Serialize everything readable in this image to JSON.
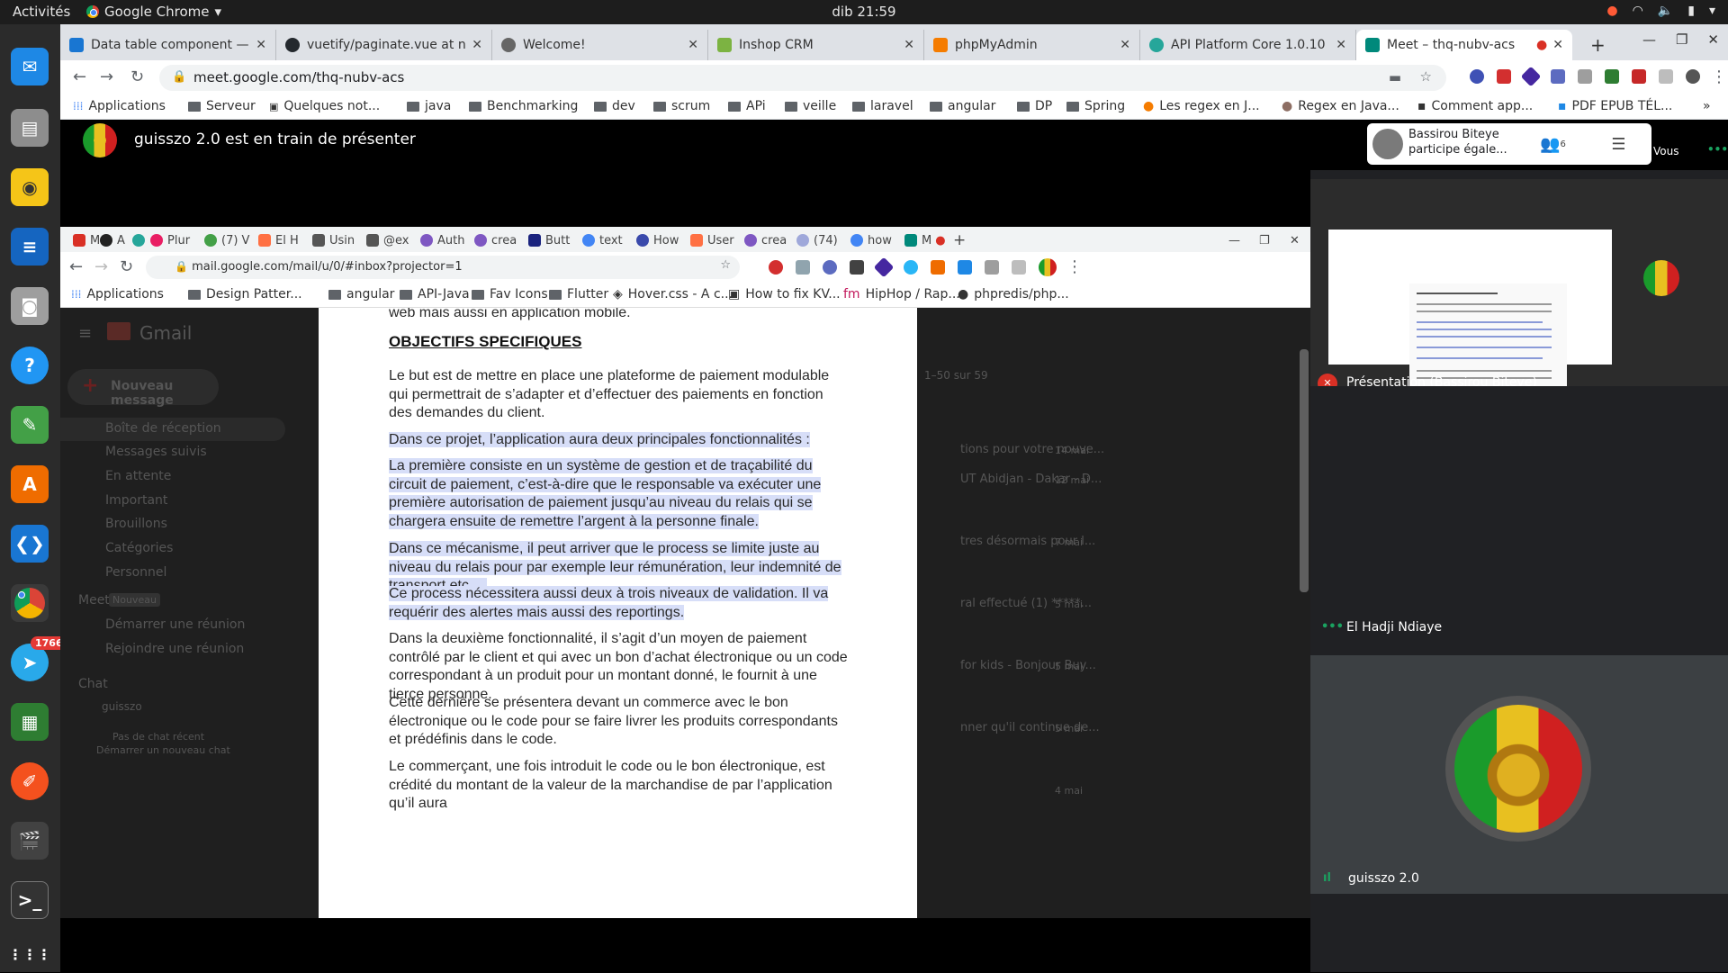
{
  "topbar": {
    "activities": "Activités",
    "app_name": "Google Chrome",
    "clock": "dib 21:59"
  },
  "dock": {
    "telegram_badge": "1766"
  },
  "chrome": {
    "tabs": [
      {
        "title": "Data table component —",
        "color": "#1976d2"
      },
      {
        "title": "vuetify/paginate.vue at n",
        "color": "#24292e"
      },
      {
        "title": "Welcome!",
        "color": "#444444"
      },
      {
        "title": "Inshop CRM",
        "color": "#7cb342"
      },
      {
        "title": "phpMyAdmin",
        "color": "#f57c00"
      },
      {
        "title": "API Platform Core 1.0.10",
        "color": "#26a69a"
      },
      {
        "title": "Meet – thq-nubv-acs",
        "color": "#00897b"
      }
    ],
    "url": "meet.google.com/thq-nubv-acs",
    "bookmarks": [
      "Applications",
      "Serveur",
      "Quelques not...",
      "java",
      "Benchmarking",
      "dev",
      "scrum",
      "APi",
      "veille",
      "laravel",
      "angular",
      "DP",
      "Spring",
      "Les regex en J...",
      "Regex en Java...",
      "Comment app...",
      "PDF EPUB TÉL..."
    ]
  },
  "meet": {
    "presenter_text": "guisszo 2.0 est en train de présenter",
    "toast_name": "Bassirou Biteye",
    "toast_text": "participe égale...",
    "people_count": "6",
    "vous": "Vous",
    "vous_dots": "•••",
    "thumb_label": "Présentation (Bassirou Biteye)",
    "tile2_name": "El Hadji Ndiaye",
    "tile2_dots": "•••",
    "tile3_name": "guisszo 2.0",
    "tile3_audio": "ıl"
  },
  "shared": {
    "tabs": [
      "M",
      "A",
      "",
      "Plur",
      "(7) V",
      "El H",
      "Usin",
      "@ex",
      "Auth",
      "crea",
      "Butt",
      "text",
      "How",
      "User",
      "crea",
      "(74)",
      "how",
      "M"
    ],
    "url": "mail.google.com/mail/u/0/#inbox?projector=1",
    "bookmarks": [
      "Applications",
      "Design Patter...",
      "angular",
      "API-Java",
      "Fav Icons",
      "Flutter",
      "Hover.css - A c...",
      "How to fix KV...",
      "HipHop / Rap...",
      "phpredis/php..."
    ],
    "gmail": {
      "brand": "Gmail",
      "compose": "Nouveau message",
      "nav": [
        "Boîte de réception",
        "Messages suivis",
        "En attente",
        "Important",
        "Brouillons",
        "Catégories",
        "Personnel"
      ],
      "meet_label": "Meet",
      "meet_new": "Nouveau",
      "meet_items": [
        "Démarrer une réunion",
        "Rejoindre une réunion"
      ],
      "chat_label": "Chat",
      "chat_user": "guisszo",
      "chat_empty": "Pas de chat récent",
      "chat_start": "Démarrer un nouveau chat",
      "counter": "1–50 sur 59",
      "snippets": [
        {
          "text": "tions pour votre nouve...",
          "date": "14 mai"
        },
        {
          "text": "UT Abidjan - Dakar - D...",
          "date": "12 mai"
        },
        {
          "text": "tres désormais pour l...",
          "date": "7 mai"
        },
        {
          "text": "ral effectué (1) *****...",
          "date": "5 mai"
        },
        {
          "text": "for kids - Bonjour Buy...",
          "date": "5 mai"
        },
        {
          "text": "nner qu'il continue de...",
          "date": "5 mai"
        },
        {
          "text": "",
          "date": "4 mai"
        }
      ]
    },
    "doc": {
      "line0": "web mais aussi en application mobile.",
      "heading": "OBJECTIFS SPECIFIQUES",
      "p1": "Le but est de mettre en place une plateforme de paiement modulable qui permettrait de s’adapter et d’effectuer des paiements en fonction des demandes du client.",
      "p2": "Dans ce projet, l’application aura deux principales fonctionnalités :",
      "p3": "La première consiste en un système de gestion et de traçabilité du circuit de paiement, c’est-à-dire que le responsable va exécuter une première autorisation de paiement jusqu’au niveau du relais qui se chargera ensuite de remettre l’argent à la personne finale.",
      "p4": "Dans ce mécanisme, il peut arriver que le process se limite juste au niveau du relais pour par exemple leur rémunération, leur indemnité de transport etc….",
      "p5": "Ce process nécessitera aussi deux à trois niveaux de validation. Il va requérir des alertes mais aussi des reportings.",
      "p6": "Dans la deuxième fonctionnalité, il s’agit d’un moyen de paiement contrôlé par le client et qui avec un bon d’achat électronique ou un code correspondant à un produit pour un montant donné, le fournit à une tierce personne.",
      "p7": "Cette dernière se présentera devant un commerce avec le bon électronique ou le code pour se faire livrer les produits correspondants et prédéfinis dans le code.",
      "p8": "Le commerçant, une fois introduit le code ou le bon électronique, est crédité du montant de la valeur de la marchandise de par l’application qu’il aura"
    }
  }
}
